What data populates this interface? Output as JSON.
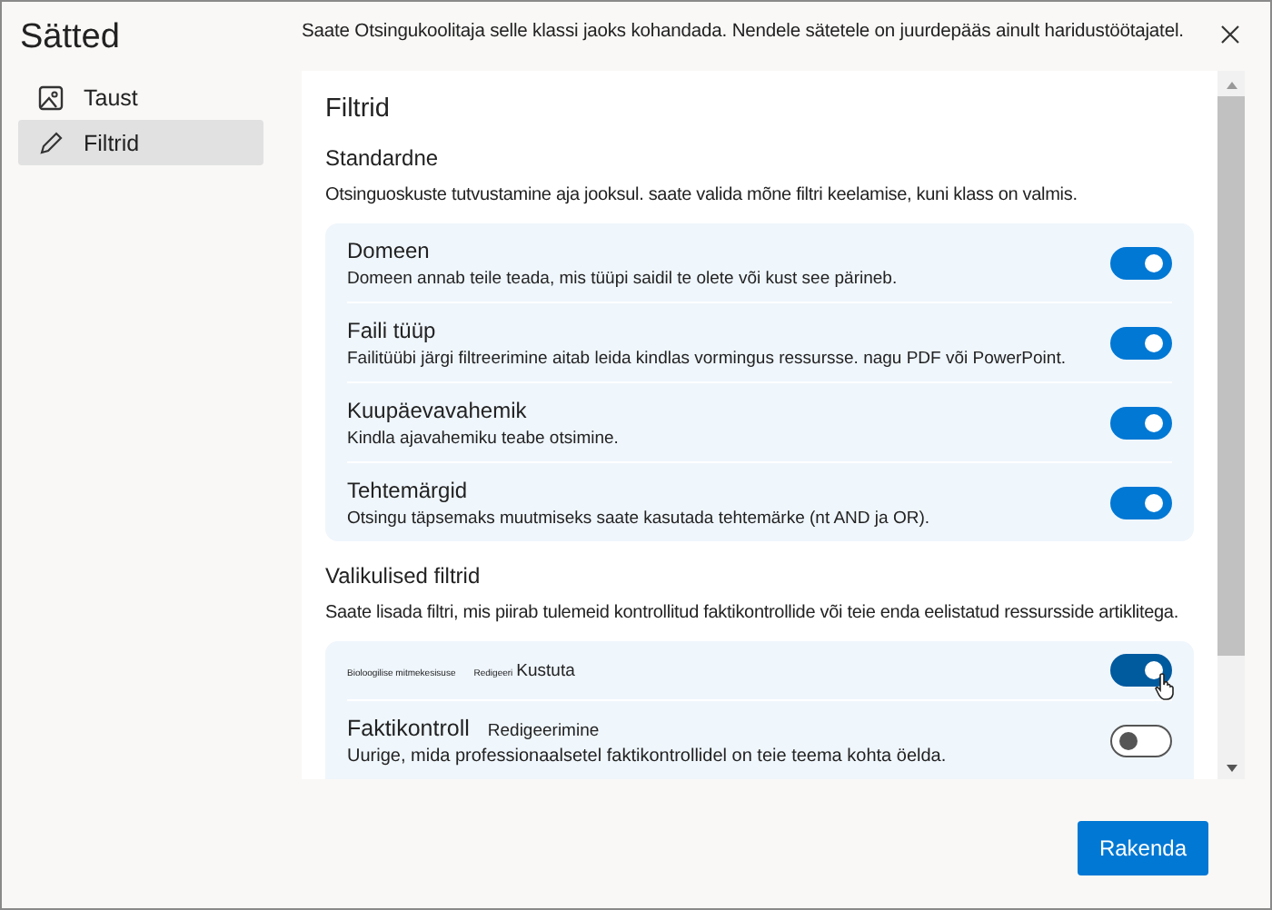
{
  "window": {
    "title": "Sätted"
  },
  "sidebar": {
    "items": [
      {
        "label": "Taust",
        "selected": false
      },
      {
        "label": "Filtrid",
        "selected": true
      }
    ]
  },
  "header": {
    "text": "Saate Otsingukoolitaja selle klassi jaoks kohandada. Nendele sätetele on juurdepääs ainult haridustöötajatel."
  },
  "panel": {
    "title": "Filtrid",
    "sections": [
      {
        "title": "Standardne",
        "description": "Otsinguoskuste tutvustamine aja jooksul. saate valida mõne filtri keelamise, kuni klass on valmis.",
        "items": [
          {
            "kind": "standard",
            "title": "Domeen",
            "description": "Domeen annab teile teada, mis tüüpi saidil te olete või kust see pärineb.",
            "on": true
          },
          {
            "kind": "standard",
            "title": "Faili tüüp",
            "description": "Failitüübi järgi filtreerimine aitab leida kindlas vormingus ressursse. nagu PDF või PowerPoint.",
            "on": true
          },
          {
            "kind": "standard",
            "title": "Kuupäevavahemik",
            "description": "Kindla ajavahemiku teabe otsimine.",
            "on": true
          },
          {
            "kind": "standard",
            "title": "Tehtemärgid",
            "description": "Otsingu täpsemaks muutmiseks saate kasutada tehtemärke (nt AND ja OR).",
            "on": true
          }
        ]
      },
      {
        "title": "Valikulised filtrid",
        "description": "Saate lisada filtri, mis piirab tulemeid kontrollitud faktikontrollide või teie enda eelistatud ressursside artiklitega.",
        "items": [
          {
            "kind": "custom",
            "title": "Bioloogilise mitmekesisuse",
            "edit": "Redigeeri",
            "delete": "Kustuta",
            "on": true,
            "hovered": true
          },
          {
            "kind": "optional",
            "title": "Faktikontroll",
            "edit": "Redigeerimine",
            "description": "Uurige, mida professionaalsetel faktikontrollidel on teie teema kohta öelda.",
            "on": false
          }
        ]
      }
    ]
  },
  "buttons": [
    {
      "label": "Rakenda"
    }
  ]
}
